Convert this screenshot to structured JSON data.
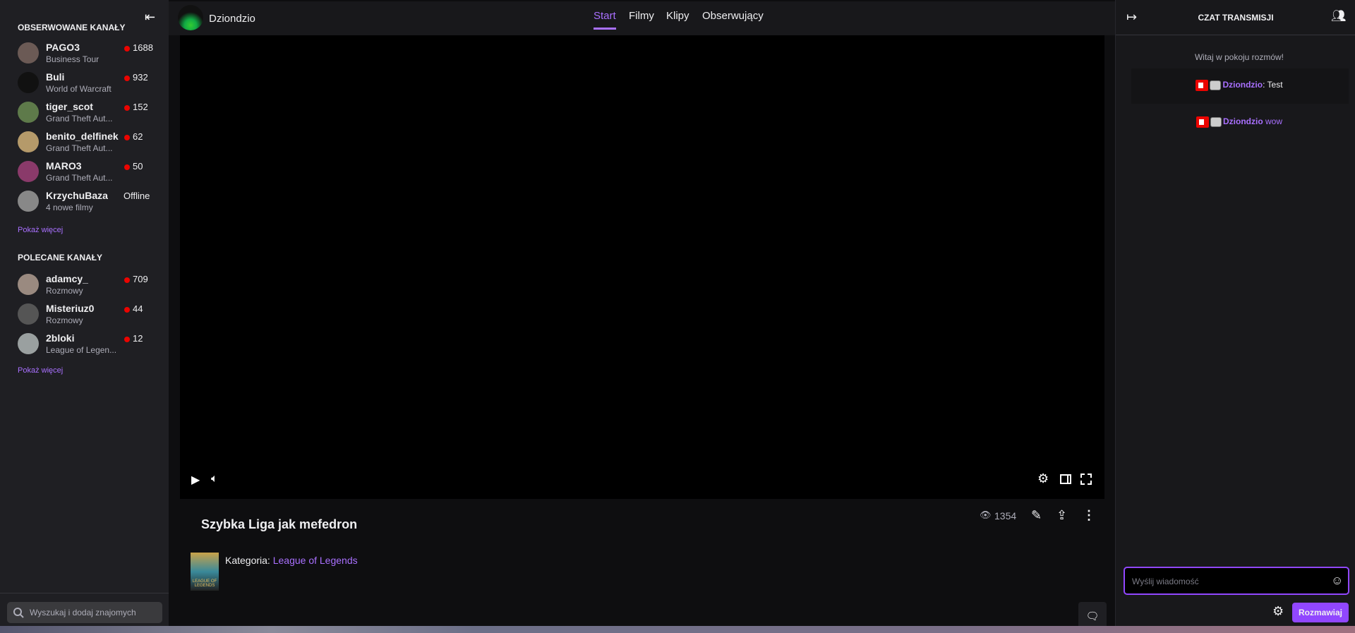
{
  "sidebar": {
    "collapse_icon": "arrow-left-bar-icon",
    "followed_title": "OBSERWOWANE KANAŁY",
    "followed": [
      {
        "name": "PAGO3",
        "game": "Business Tour",
        "viewers": "1688",
        "color": "#6b5a55"
      },
      {
        "name": "Buli",
        "game": "World of Warcraft",
        "viewers": "932",
        "color": "#111"
      },
      {
        "name": "tiger_scot",
        "game": "Grand Theft Aut...",
        "viewers": "152",
        "color": "#5e7a4a"
      },
      {
        "name": "benito_delfinek",
        "game": "Grand Theft Aut...",
        "viewers": "62",
        "color": "#b59a6a"
      },
      {
        "name": "MARO3",
        "game": "Grand Theft Aut...",
        "viewers": "50",
        "color": "#8a3a6a"
      },
      {
        "name": "KrzychuBaza",
        "game": "4 nowe filmy",
        "status": "Offline",
        "color": "#888"
      }
    ],
    "show_more": "Pokaż więcej",
    "recommended_title": "POLECANE KANAŁY",
    "recommended": [
      {
        "name": "adamcy_",
        "game": "Rozmowy",
        "viewers": "709",
        "color": "#9a8a80"
      },
      {
        "name": "Misteriuz0",
        "game": "Rozmowy",
        "viewers": "44",
        "color": "#555"
      },
      {
        "name": "2bloki",
        "game": "League of Legen...",
        "viewers": "12",
        "color": "#9aa0a0"
      }
    ],
    "show_more2": "Pokaż więcej",
    "search_placeholder": "Wyszukaj i dodaj znajomych"
  },
  "header": {
    "channel": "Dziondzio",
    "tabs": [
      "Start",
      "Filmy",
      "Klipy",
      "Obserwujący"
    ],
    "active_tab": "Start"
  },
  "video": {
    "title": "Szybka Liga jak mefedron",
    "views": "1354",
    "category_label": "Kategoria:",
    "category": "League of Legends",
    "thumb_text": "LEAGUE OF LEGENDS"
  },
  "chat": {
    "title": "CZAT TRANSMISJI",
    "welcome": "Witaj w pokoju rozmów!",
    "messages": [
      {
        "user": "Dziondzio",
        "sep": ":",
        "text": " Test"
      },
      {
        "user": "Dziondzio",
        "sep": "",
        "text": " wow"
      }
    ],
    "input_placeholder": "Wyślij wiadomość",
    "send": "Rozmawiaj"
  },
  "colors": {
    "accent": "#a970ff",
    "live": "#eb0400"
  }
}
